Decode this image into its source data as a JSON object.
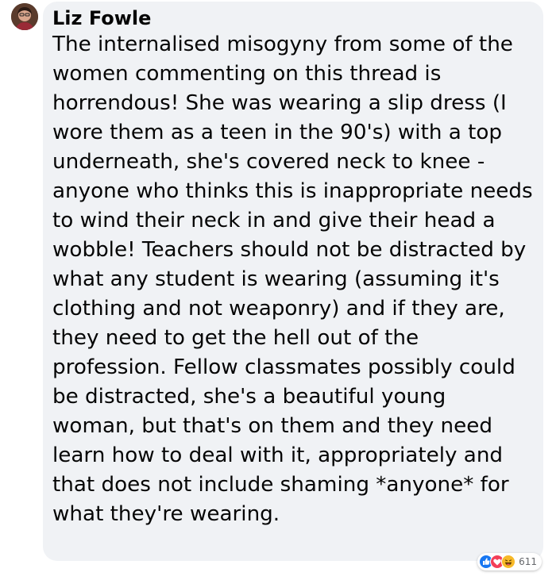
{
  "comment": {
    "author": "Liz Fowle",
    "text": "The internalised misogyny from some of the women commenting on this thread is horrendous! She was wearing a slip dress (I wore them as a teen in the 90's) with a top underneath, she's covered neck to knee - anyone who thinks this is inappropriate needs to wind their neck in and give their head a wobble! Teachers should not be distracted by what any student is wearing (assuming it's clothing and not weaponry) and if they are, they need to get the hell out of the profession. Fellow classmates possibly could be distracted, she's a beautiful young woman, but that's on them and they need learn how to deal with it, appropriately and that does not include shaming *anyone* for what they're wearing.",
    "reactions": {
      "icons": [
        "like-icon",
        "love-icon",
        "haha-icon"
      ],
      "count": "611"
    }
  },
  "colors": {
    "bubble": "#f0f2f5",
    "like": "#1877f2",
    "love": "#f33e58",
    "haha": "#f7b928",
    "count_text": "#65676b"
  }
}
